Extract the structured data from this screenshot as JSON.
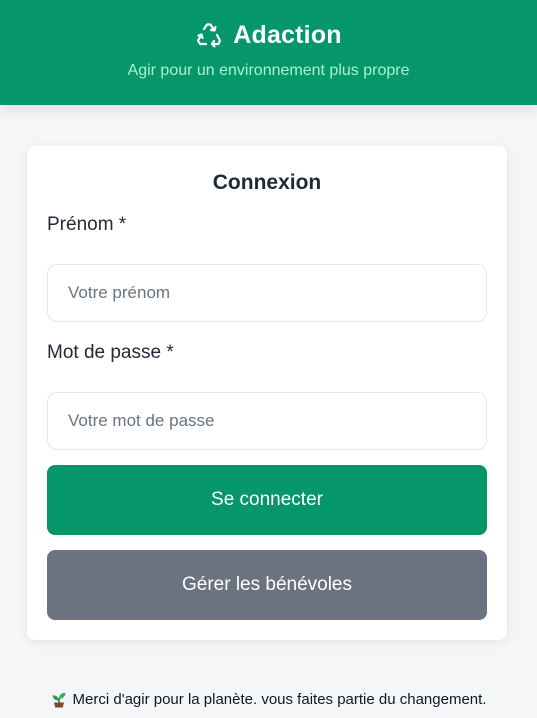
{
  "header": {
    "brand_icon": "recycle-icon",
    "title": "Adaction",
    "tagline": "Agir pour un environnement plus propre"
  },
  "login": {
    "title": "Connexion",
    "firstname_label": "Prénom *",
    "firstname_placeholder": "Votre prénom",
    "password_label": "Mot de passe *",
    "password_placeholder": "Votre mot de passe",
    "login_button": "Se connecter",
    "manage_button": "Gérer les bénévoles"
  },
  "footer": {
    "icon": "seedling-icon",
    "text": "Merci d'agir pour la planète. vous faites partie du changement."
  },
  "colors": {
    "primary": "#059669",
    "secondary": "#6b7280",
    "tagline": "#a7f3d0"
  }
}
